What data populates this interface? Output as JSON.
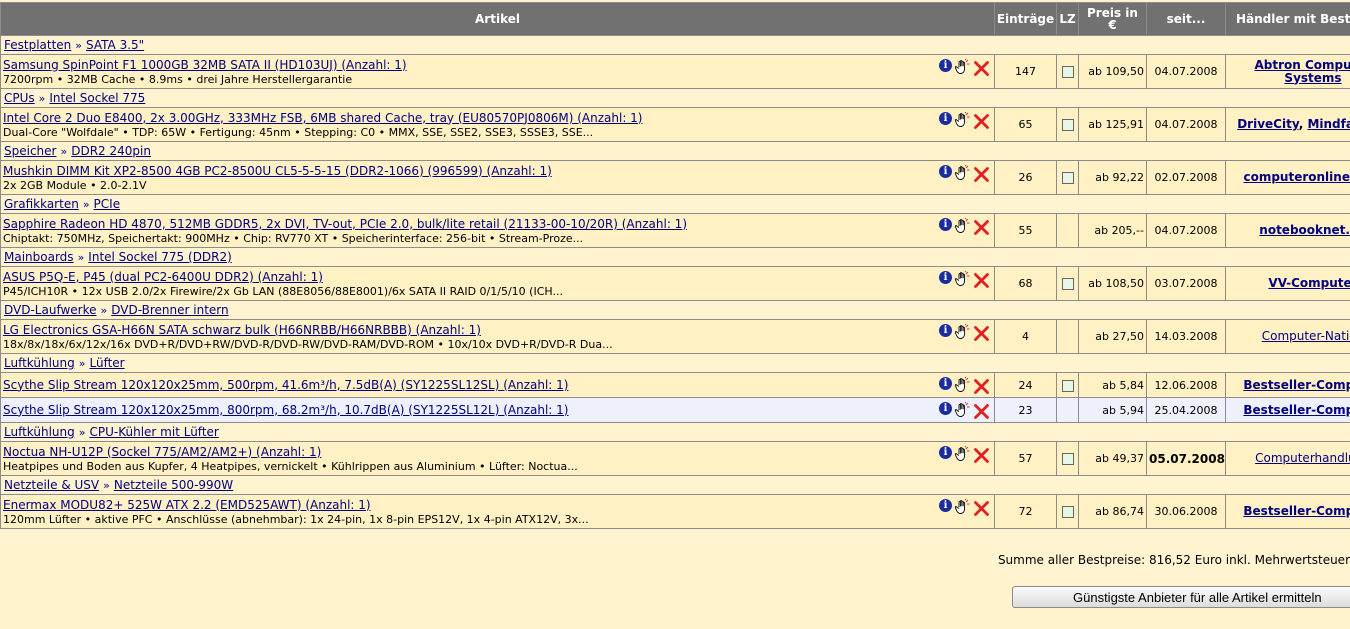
{
  "headers": {
    "artikel": "Artikel",
    "eintraege": "Einträge",
    "lz": "LZ",
    "preis_line1": "Preis in",
    "preis_line2": "€",
    "seit": "seit...",
    "haendler": "Händler mit Bestpreis"
  },
  "rows": [
    {
      "type": "cat",
      "c1": "Festplatten",
      "c2": "SATA 3.5\""
    },
    {
      "type": "prod",
      "name": "Samsung SpinPoint F1 1000GB 32MB SATA II (HD103UJ) (Anzahl: 1)",
      "desc": "7200rpm • 32MB Cache • 8.9ms • drei Jahre Herstellergarantie",
      "entries": "147",
      "lz": true,
      "price": "ab 109,50",
      "date": "04.07.2008",
      "dealer": "Abtron Computer",
      "dealer2": "Systems"
    },
    {
      "type": "cat",
      "c1": "CPUs",
      "c2": "Intel Sockel 775"
    },
    {
      "type": "prod",
      "name": "Intel Core 2 Duo E8400, 2x 3.00GHz, 333MHz FSB, 6MB shared Cache, tray (EU80570PJ0806M) (Anzahl: 1)",
      "desc": "Dual-Core \"Wolfdale\" • TDP: 65W • Fertigung: 45nm • Stepping: C0 • MMX, SSE, SSE2, SSE3, SSSE3, SSE...",
      "entries": "65",
      "lz": true,
      "price": "ab 125,91",
      "date": "04.07.2008",
      "dealer": "DriveCity",
      "dealer_b": "Mindfactory"
    },
    {
      "type": "cat",
      "c1": "Speicher",
      "c2": "DDR2 240pin"
    },
    {
      "type": "prod",
      "name": "Mushkin DIMM Kit XP2-8500 4GB PC2-8500U CL5-5-5-15 (DDR2-1066) (996599) (Anzahl: 1)",
      "desc": "2x 2GB Module • 2.0-2.1V",
      "entries": "26",
      "lz": true,
      "price": "ab 92,22",
      "date": "02.07.2008",
      "dealer": "computeronlineshop"
    },
    {
      "type": "cat",
      "c1": "Grafikkarten",
      "c2": "PCIe"
    },
    {
      "type": "prod",
      "name": "Sapphire Radeon HD 4870, 512MB GDDR5, 2x DVI, TV-out, PCIe 2.0, bulk/lite retail (21133-00-10/20R) (Anzahl: 1)",
      "desc": "Chiptakt: 750MHz, Speichertakt: 900MHz • Chip: RV770 XT • Speicherinterface: 256-bit • Stream-Proze...",
      "entries": "55",
      "lz": false,
      "price": "ab 205,--",
      "date": "04.07.2008",
      "dealer": "notebooknet.de"
    },
    {
      "type": "cat",
      "c1": "Mainboards",
      "c2": "Intel Sockel 775 (DDR2)"
    },
    {
      "type": "prod",
      "name": "ASUS P5Q-E, P45 (dual PC2-6400U DDR2) (Anzahl: 1)",
      "desc": "P45/ICH10R • 12x USB 2.0/2x Firewire/2x Gb LAN (88E8056/88E8001)/6x SATA II RAID 0/1/5/10 (ICH...",
      "entries": "68",
      "lz": true,
      "price": "ab 108,50",
      "date": "03.07.2008",
      "dealer": "VV-Computer"
    },
    {
      "type": "cat",
      "c1": "DVD-Laufwerke",
      "c2": "DVD-Brenner intern"
    },
    {
      "type": "prod",
      "name": "LG Electronics GSA-H66N SATA schwarz bulk (H66NRBB/H66NRBBB) (Anzahl: 1)",
      "desc": "18x/8x/18x/6x/12x/16x DVD+R/DVD+RW/DVD-R/DVD-RW/DVD-RAM/DVD-ROM • 10x/10x DVD+R/DVD-R Dua...",
      "entries": "4",
      "lz": false,
      "price": "ab 27,50",
      "date": "14.03.2008",
      "dealer": "Computer-Nation",
      "normal": true
    },
    {
      "type": "cat",
      "c1": "Luftkühlung",
      "c2": "Lüfter"
    },
    {
      "type": "prod",
      "single": true,
      "name": "Scythe Slip Stream 120x120x25mm, 500rpm, 41.6m³/h, 7.5dB(A) (SY1225SL12SL) (Anzahl: 1)",
      "desc": "",
      "entries": "24",
      "lz": true,
      "price": "ab 5,84",
      "date": "12.06.2008",
      "dealer": "Bestseller-Computer"
    },
    {
      "type": "prod",
      "single": true,
      "alt": true,
      "name": "Scythe Slip Stream 120x120x25mm, 800rpm, 68.2m³/h, 10.7dB(A) (SY1225SL12L) (Anzahl: 1)",
      "desc": "",
      "entries": "23",
      "lz": false,
      "price": "ab 5,94",
      "date": "25.04.2008",
      "dealer": "Bestseller-Computer"
    },
    {
      "type": "cat",
      "c1": "Luftkühlung",
      "c2": "CPU-Kühler mit Lüfter"
    },
    {
      "type": "prod",
      "name": "Noctua NH-U12P (Sockel 775/AM2/AM2+) (Anzahl: 1)",
      "desc": "Heatpipes und Boden aus Kupfer, 4 Heatpipes, vernickelt • Kühlrippen aus Aluminium • Lüfter: Noctua...",
      "entries": "57",
      "lz": true,
      "price": "ab 49,37",
      "date": "05.07.2008",
      "datebold": true,
      "dealer": "Computerhandlung",
      "normal": true
    },
    {
      "type": "cat",
      "c1": "Netzteile & USV",
      "c2": "Netzteile 500-990W"
    },
    {
      "type": "prod",
      "name": "Enermax MODU82+ 525W ATX 2.2 (EMD525AWT) (Anzahl: 1)",
      "desc": "120mm Lüfter • aktive PFC • Anschlüsse (abnehmbar): 1x 24-pin, 1x 8-pin EPS12V, 1x 4-pin ATX12V, 3x...",
      "entries": "72",
      "lz": true,
      "price": "ab 86,74",
      "date": "30.06.2008",
      "dealer": "Bestseller-Computer"
    }
  ],
  "summary": "Summe aller Bestpreise: 816,52 Euro inkl. Mehrwertsteuer",
  "button_label": "Günstigste Anbieter für alle Artikel ermitteln",
  "icons": {
    "info": "info-icon",
    "hand": "hand-pointer-icon",
    "delete": "delete-x-icon"
  },
  "colors": {
    "header_bg": "#717171",
    "row_bg": "#fff1c4",
    "page_bg": "#fff4cf",
    "link": "#000080",
    "delete": "#e02020"
  }
}
